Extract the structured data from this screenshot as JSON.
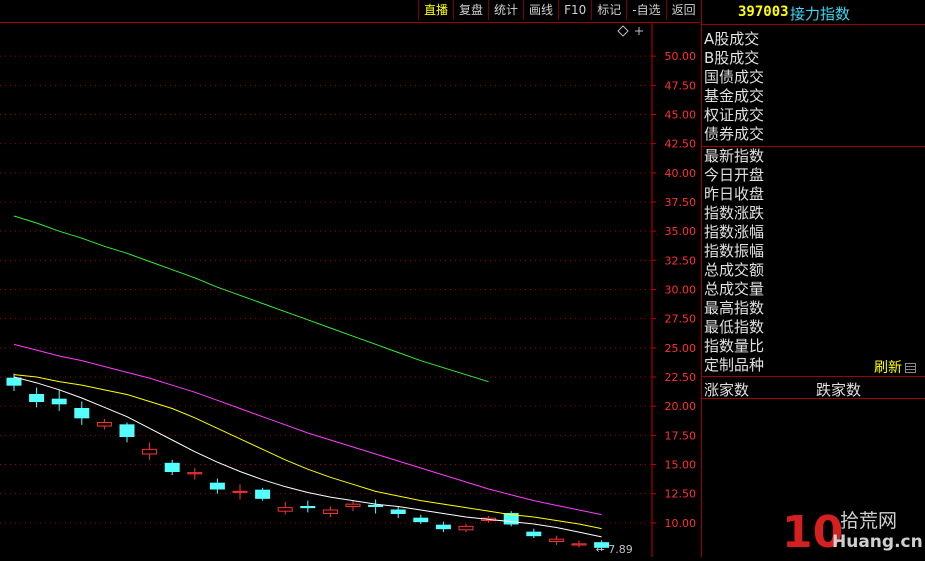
{
  "toolbar": {
    "buttons": [
      "直播",
      "复盘",
      "统计",
      "画线",
      "F10",
      "标记",
      "-自选",
      "返回"
    ]
  },
  "panel": {
    "code": "397003",
    "name": "接力指数",
    "group1": [
      "A股成交",
      "B股成交",
      "国债成交",
      "基金成交",
      "权证成交",
      "债券成交"
    ],
    "group2": [
      "最新指数",
      "今日开盘",
      "昨日收盘",
      "指数涨跌",
      "指数涨幅",
      "指数振幅",
      "总成交额",
      "总成交量",
      "最高指数",
      "最低指数",
      "指数量比",
      "定制品种"
    ],
    "refresh": "刷新",
    "ups": "涨家数",
    "downs": "跌家数"
  },
  "watermark": {
    "num": "10",
    "site": "拾荒网",
    "url": "Huang.cn"
  },
  "chart_data": {
    "type": "candlestick",
    "ylim": [
      7.5,
      52.5
    ],
    "yticks": [
      "50.00",
      "47.50",
      "45.00",
      "42.50",
      "40.00",
      "37.50",
      "35.00",
      "32.50",
      "30.00",
      "27.50",
      "25.00",
      "22.50",
      "20.00",
      "17.50",
      "15.00",
      "12.50",
      "10.00"
    ],
    "last_label": "← 7.89",
    "up_color": "#ff3232",
    "down_color": "#54ffff",
    "candles": [
      {
        "o": 22.4,
        "c": 21.8,
        "h": 22.8,
        "l": 21.3
      },
      {
        "o": 21.0,
        "c": 20.4,
        "h": 21.6,
        "l": 19.9
      },
      {
        "o": 20.6,
        "c": 20.2,
        "h": 21.4,
        "l": 19.6
      },
      {
        "o": 19.8,
        "c": 19.0,
        "h": 20.4,
        "l": 18.4
      },
      {
        "o": 18.3,
        "c": 18.6,
        "h": 18.9,
        "l": 18.0
      },
      {
        "o": 18.4,
        "c": 17.4,
        "h": 18.6,
        "l": 16.9
      },
      {
        "o": 15.9,
        "c": 16.3,
        "h": 16.9,
        "l": 15.4
      },
      {
        "o": 15.1,
        "c": 14.4,
        "h": 15.4,
        "l": 14.1
      },
      {
        "o": 14.2,
        "c": 14.3,
        "h": 14.7,
        "l": 13.7
      },
      {
        "o": 13.4,
        "c": 12.9,
        "h": 13.8,
        "l": 12.5
      },
      {
        "o": 12.7,
        "c": 12.7,
        "h": 13.3,
        "l": 12.0
      },
      {
        "o": 12.8,
        "c": 12.1,
        "h": 13.0,
        "l": 11.9
      },
      {
        "o": 11.0,
        "c": 11.3,
        "h": 11.8,
        "l": 10.7
      },
      {
        "o": 11.4,
        "c": 11.3,
        "h": 11.9,
        "l": 10.9
      },
      {
        "o": 10.8,
        "c": 11.1,
        "h": 11.4,
        "l": 10.5
      },
      {
        "o": 11.4,
        "c": 11.6,
        "h": 11.9,
        "l": 11.0
      },
      {
        "o": 11.5,
        "c": 11.4,
        "h": 12.0,
        "l": 10.8
      },
      {
        "o": 11.1,
        "c": 10.8,
        "h": 11.4,
        "l": 10.4
      },
      {
        "o": 10.4,
        "c": 10.1,
        "h": 10.7,
        "l": 9.9
      },
      {
        "o": 9.8,
        "c": 9.5,
        "h": 10.1,
        "l": 9.2
      },
      {
        "o": 9.4,
        "c": 9.7,
        "h": 9.9,
        "l": 9.2
      },
      {
        "o": 10.2,
        "c": 10.4,
        "h": 10.6,
        "l": 10.0
      },
      {
        "o": 10.8,
        "c": 9.9,
        "h": 11.0,
        "l": 9.7
      },
      {
        "o": 9.2,
        "c": 8.9,
        "h": 9.5,
        "l": 8.7
      },
      {
        "o": 8.4,
        "c": 8.6,
        "h": 8.9,
        "l": 8.1
      },
      {
        "o": 8.1,
        "c": 8.2,
        "h": 8.5,
        "l": 7.9
      },
      {
        "o": 8.3,
        "c": 7.9,
        "h": 8.5,
        "l": 7.6
      }
    ],
    "ma": [
      {
        "color": "#ffffff",
        "values": [
          22.5,
          22.0,
          21.4,
          20.7,
          19.9,
          19.1,
          18.1,
          17.1,
          16.1,
          15.2,
          14.4,
          13.7,
          13.1,
          12.6,
          12.2,
          11.9,
          11.6,
          11.4,
          11.1,
          10.8,
          10.5,
          10.3,
          10.1,
          9.9,
          9.6,
          9.2,
          8.8
        ]
      },
      {
        "color": "#ffff00",
        "values": [
          22.7,
          22.5,
          22.1,
          21.8,
          21.4,
          21.0,
          20.4,
          19.8,
          19.0,
          18.1,
          17.2,
          16.3,
          15.4,
          14.6,
          13.9,
          13.3,
          12.7,
          12.3,
          11.9,
          11.6,
          11.3,
          11.0,
          10.7,
          10.5,
          10.2,
          9.9,
          9.5
        ]
      },
      {
        "color": "#ff3cff",
        "values": [
          25.3,
          24.8,
          24.3,
          23.9,
          23.4,
          22.9,
          22.4,
          21.8,
          21.2,
          20.5,
          19.8,
          19.1,
          18.4,
          17.7,
          17.1,
          16.5,
          15.9,
          15.3,
          14.7,
          14.1,
          13.5,
          12.9,
          12.4,
          11.9,
          11.5,
          11.1,
          10.7
        ]
      },
      {
        "color": "#33ee33",
        "values": [
          36.3,
          35.7,
          35.0,
          34.4,
          33.7,
          33.1,
          32.4,
          31.7,
          31.0,
          30.2,
          29.5,
          28.8,
          28.1,
          27.4,
          26.7,
          26.0,
          25.3,
          24.6,
          23.9,
          23.3,
          22.7,
          22.1
        ]
      }
    ]
  }
}
